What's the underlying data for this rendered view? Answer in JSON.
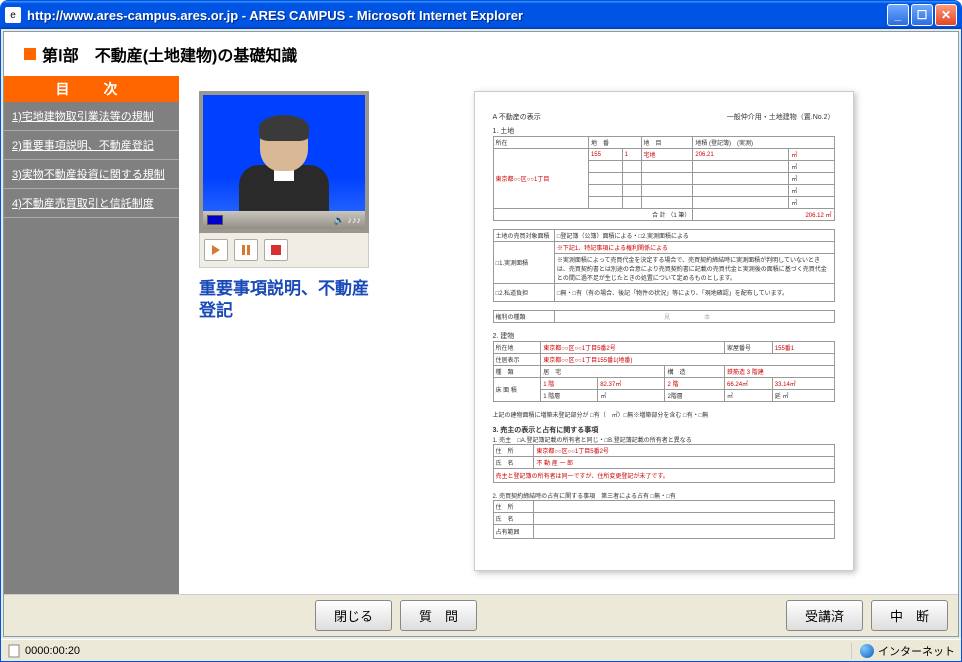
{
  "window": {
    "title": "http://www.ares-campus.ares.or.jp - ARES CAMPUS - Microsoft Internet Explorer"
  },
  "page": {
    "heading": "第Ⅰ部　不動産(土地建物)の基礎知識"
  },
  "toc": {
    "header": "目　次",
    "items": [
      "1)宅地建物取引業法等の規制",
      "2)重要事項説明、不動産登記",
      "3)実物不動産投資に関する規制",
      "4)不動産売買取引と信託制度"
    ]
  },
  "video": {
    "title": "重要事項説明、不動産登記",
    "sound_glyphs": "🔊 ♪♪♪"
  },
  "document": {
    "title_left": "A 不動産の表示",
    "title_right": "一般仲介用・土地建物（置.No.2）",
    "section1": "1. 土地",
    "row1_addr": "東京都○○区○○1丁目",
    "row1_vals": [
      "155",
      "番",
      "1",
      "宅地",
      "206.21",
      "㎡"
    ],
    "total_label": "合 計 （1 筆）",
    "total_val": "206.12 ㎡",
    "note_red": "※下記1、特記事項による権利関係による",
    "mihon": "見　本",
    "section2": "2. 建物",
    "b_addr1": "東京都○○区○○1丁目5番2号",
    "b_addr2": "東京都○○区○○1丁目155番1(地番)",
    "b_struct": "鉄筋造 3 階建",
    "b_vals": [
      "1 階",
      "82.37㎡",
      "2 階",
      "66.24㎡",
      "延 面 積",
      "33.14㎡"
    ],
    "section3": "3. 売主の表示と占有に関する事項",
    "s3_line1": "1. 売主　□A.登記簿記載の所有者と同じ・□B.登記簿記載の所有者と異なる",
    "s3_addr": "東京都○○区○○1丁目5番2号",
    "s3_name": "不 動 産 一 郎",
    "s3_note": "売主と登記簿の所有者は同一ですが、住所変更登記が未了です。",
    "s3_line2": "2. 売買契約締結時の占有に関する事項　第三者による占有 □無・□有",
    "footer_btns": {
      "close": "閉じる",
      "question": "質　問",
      "completed": "受講済",
      "interrupt": "中　断"
    }
  },
  "statusbar": {
    "time": "0000:00:20",
    "zone": "インターネット"
  }
}
